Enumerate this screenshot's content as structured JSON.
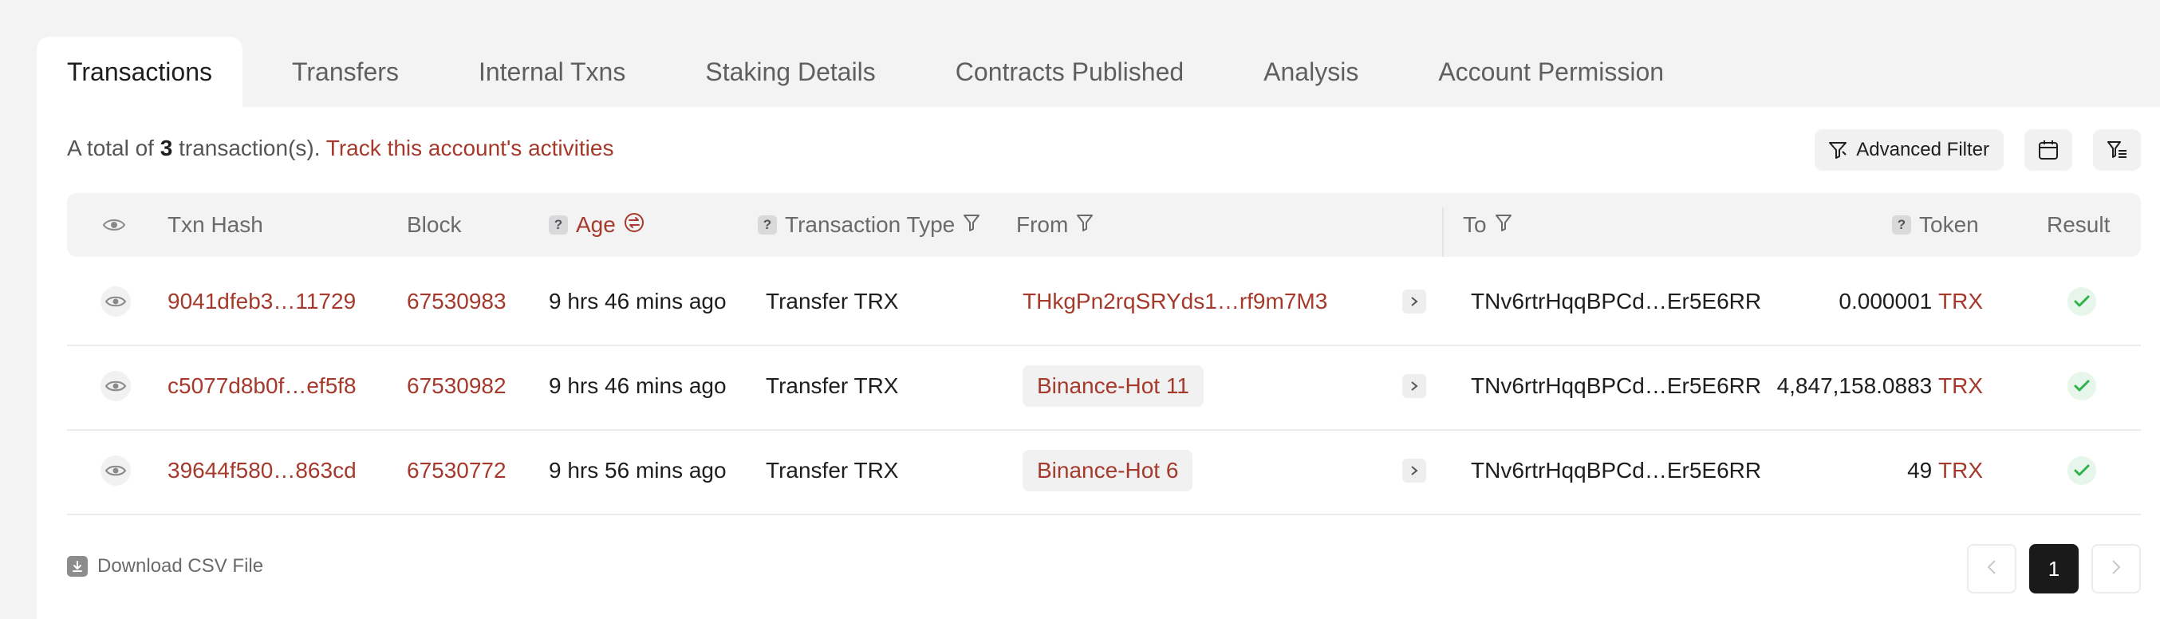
{
  "tabs": [
    {
      "label": "Transactions"
    },
    {
      "label": "Transfers"
    },
    {
      "label": "Internal Txns"
    },
    {
      "label": "Staking Details"
    },
    {
      "label": "Contracts Published"
    },
    {
      "label": "Analysis"
    },
    {
      "label": "Account Permission"
    }
  ],
  "summary": {
    "prefix": "A total of",
    "count": "3",
    "suffix": "transaction(s).",
    "track_link": "Track this account's activities"
  },
  "toolbar": {
    "advanced_filter_label": "Advanced Filter",
    "icons": [
      "filter-icon",
      "calendar-icon",
      "column-settings-icon"
    ]
  },
  "table": {
    "headers": {
      "txn_hash": "Txn Hash",
      "block": "Block",
      "age": "Age",
      "type": "Transaction Type",
      "from": "From",
      "to": "To",
      "token": "Token",
      "result": "Result"
    },
    "rows": [
      {
        "hash": "9041dfeb3…11729",
        "block": "67530983",
        "age": "9 hrs 46 mins ago",
        "type": "Transfer TRX",
        "from": "THkgPn2rqSRYds1…rf9m7M3",
        "from_tag": false,
        "to": "TNv6rtrHqqBPCd…Er5E6RR",
        "amount": "0.000001",
        "token": "TRX"
      },
      {
        "hash": "c5077d8b0f…ef5f8",
        "block": "67530982",
        "age": "9 hrs 46 mins ago",
        "type": "Transfer TRX",
        "from": "Binance-Hot 11",
        "from_tag": true,
        "to": "TNv6rtrHqqBPCd…Er5E6RR",
        "amount": "4,847,158.0883",
        "token": "TRX"
      },
      {
        "hash": "39644f580…863cd",
        "block": "67530772",
        "age": "9 hrs 56 mins ago",
        "type": "Transfer TRX",
        "from": "Binance-Hot 6",
        "from_tag": true,
        "to": "TNv6rtrHqqBPCd…Er5E6RR",
        "amount": "49",
        "token": "TRX"
      }
    ]
  },
  "footer": {
    "download_csv": "Download CSV File",
    "current_page": "1"
  },
  "colors": {
    "accent": "#a53a2c",
    "success": "#2fb34a",
    "page_bg": "#f3f3f4"
  }
}
